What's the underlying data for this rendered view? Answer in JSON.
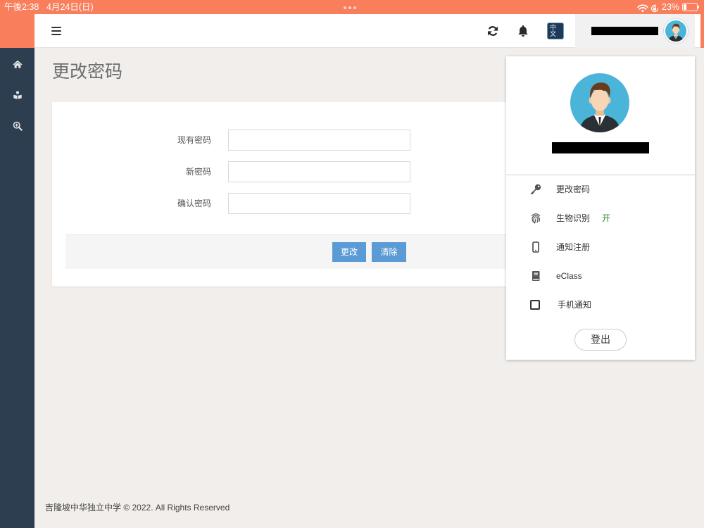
{
  "status_bar": {
    "time": "午後2:38",
    "date": "4月24日(日)",
    "battery": "23%",
    "icons": [
      "wifi-icon",
      "orientation-lock-icon",
      "battery-icon"
    ]
  },
  "header": {
    "icons": [
      "hamburger-icon",
      "refresh-icon",
      "bell-icon"
    ],
    "language_label": "中文"
  },
  "sidebar": {
    "items": [
      {
        "icon": "home-icon"
      },
      {
        "icon": "reader-icon"
      },
      {
        "icon": "search-plus-icon"
      }
    ]
  },
  "page": {
    "title": "更改密码"
  },
  "form": {
    "fields": [
      {
        "label": "现有密码",
        "value": ""
      },
      {
        "label": "新密码",
        "value": ""
      },
      {
        "label": "确认密码",
        "value": ""
      }
    ],
    "submit_label": "更改",
    "clear_label": "清除"
  },
  "user_menu": {
    "items": [
      {
        "icon": "key-icon",
        "label": "更改密码"
      },
      {
        "icon": "fingerprint-icon",
        "label": "生物识别",
        "status": "开"
      },
      {
        "icon": "mobile-icon",
        "label": "通知注册"
      },
      {
        "icon": "book-icon",
        "label": "eClass"
      },
      {
        "icon": "checkbox",
        "label": "手机通知",
        "checked": false
      }
    ],
    "logout_label": "登出"
  },
  "footer": {
    "copyright": "吉隆坡中华独立中学 © 2022. All Rights Reserved"
  },
  "colors": {
    "accent": "#F97E5C",
    "sidebar": "#2C3E50",
    "button": "#5A9BD6",
    "status_on": "#2E8B2E",
    "background": "#F1EEEB"
  }
}
